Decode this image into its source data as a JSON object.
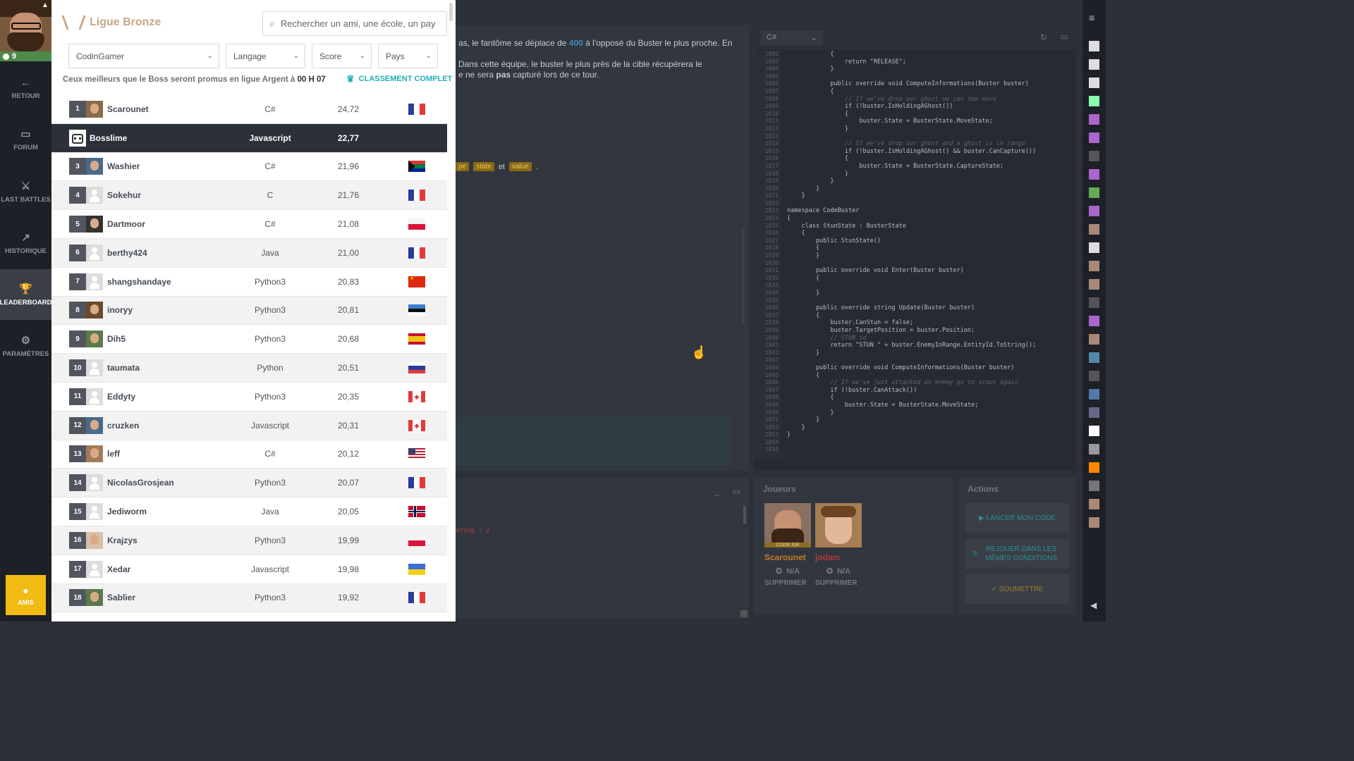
{
  "user": {
    "level": "9"
  },
  "nav": [
    {
      "id": "retour",
      "label": "RETOUR",
      "icon": "arrow-left-icon",
      "glyph": "←"
    },
    {
      "id": "forum",
      "label": "FORUM",
      "icon": "chat-icon",
      "glyph": "▭"
    },
    {
      "id": "last-battles",
      "label": "LAST BATTLES",
      "icon": "swords-icon",
      "glyph": "⚔"
    },
    {
      "id": "historique",
      "label": "HISTORIQUE",
      "icon": "chart-line-icon",
      "glyph": "↗"
    },
    {
      "id": "leaderboard",
      "label": "LEADERBOARD",
      "icon": "trophy-icon",
      "glyph": "🏆"
    },
    {
      "id": "parametres",
      "label": "PARAMÈTRES",
      "icon": "gear-icon",
      "glyph": "⚙"
    }
  ],
  "amis_label": "AMIS",
  "leaderboard": {
    "league": "Ligue Bronze",
    "search_placeholder": "Rechercher un ami, une école, un pays, ...",
    "filters": [
      "CodinGamer",
      "Langage",
      "Score",
      "Pays"
    ],
    "promo_text": "Ceux meilleurs que le Boss seront promus en ligue Argent à ",
    "promo_time": "00 H 07",
    "full_ranking": "CLASSEMENT COMPLET",
    "rows": [
      {
        "rank": "1",
        "name": "Scarounet",
        "lang": "C#",
        "score": "24,72",
        "flag": "fr",
        "avatar": "photo"
      },
      {
        "rank": "",
        "name": "Bosslime",
        "lang": "Javascript",
        "score": "22,77",
        "flag": "",
        "avatar": "boss",
        "boss": true
      },
      {
        "rank": "3",
        "name": "Washier",
        "lang": "C#",
        "score": "21,96",
        "flag": "za",
        "avatar": "photo"
      },
      {
        "rank": "4",
        "name": "Sokehur",
        "lang": "C",
        "score": "21,76",
        "flag": "fr",
        "avatar": "default"
      },
      {
        "rank": "5",
        "name": "Dartmoor",
        "lang": "C#",
        "score": "21,08",
        "flag": "pl",
        "avatar": "photo"
      },
      {
        "rank": "6",
        "name": "berthy424",
        "lang": "Java",
        "score": "21,00",
        "flag": "fr",
        "avatar": "default"
      },
      {
        "rank": "7",
        "name": "shangshandaye",
        "lang": "Python3",
        "score": "20,83",
        "flag": "cn",
        "avatar": "default"
      },
      {
        "rank": "8",
        "name": "inoryy",
        "lang": "Python3",
        "score": "20,81",
        "flag": "ee",
        "avatar": "photo"
      },
      {
        "rank": "9",
        "name": "Dih5",
        "lang": "Python3",
        "score": "20,68",
        "flag": "es",
        "avatar": "photo"
      },
      {
        "rank": "10",
        "name": "taumata",
        "lang": "Python",
        "score": "20,51",
        "flag": "ru",
        "avatar": "default"
      },
      {
        "rank": "11",
        "name": "Eddyty",
        "lang": "Python3",
        "score": "20,35",
        "flag": "ca",
        "avatar": "default"
      },
      {
        "rank": "12",
        "name": "cruzken",
        "lang": "Javascript",
        "score": "20,31",
        "flag": "ca",
        "avatar": "photo"
      },
      {
        "rank": "13",
        "name": "leff",
        "lang": "C#",
        "score": "20,12",
        "flag": "us",
        "avatar": "photo"
      },
      {
        "rank": "14",
        "name": "NicolasGrosjean",
        "lang": "Python3",
        "score": "20,07",
        "flag": "fr",
        "avatar": "default"
      },
      {
        "rank": "15",
        "name": "Jediworm",
        "lang": "Java",
        "score": "20,05",
        "flag": "no",
        "avatar": "default"
      },
      {
        "rank": "16",
        "name": "Krajzys",
        "lang": "Python3",
        "score": "19,99",
        "flag": "pl",
        "avatar": "photo"
      },
      {
        "rank": "17",
        "name": "Xedar",
        "lang": "Javascript",
        "score": "19,98",
        "flag": "ua",
        "avatar": "default"
      },
      {
        "rank": "18",
        "name": "Sablier",
        "lang": "Python3",
        "score": "19,92",
        "flag": "fr",
        "avatar": "photo"
      }
    ]
  },
  "statement": {
    "line1_a": "as, le fantôme se déplace de ",
    "line1_num": "400",
    "line1_b": " à l'opposé du Buster le plus proche. En",
    "line2": "Dans cette équipe, le buster le plus près de la cible récupérera le",
    "line3_a": "e ne sera ",
    "line3_b": "pas",
    "line3_c": " capturé lors de ce tour.",
    "tag1": "pe",
    "tag2": "state",
    "tag_sep": "et",
    "tag3": "value",
    "tag_end": "."
  },
  "editor": {
    "language": "C#",
    "code": [
      [
        "            {",
        ""
      ],
      [
        "                return \"RELEASE\";",
        ""
      ],
      [
        "            }",
        ""
      ],
      [
        "",
        ""
      ],
      [
        "            public override void ComputeInformations(Buster buster)",
        ""
      ],
      [
        "            {",
        ""
      ],
      [
        "                // If we've drop our ghost we can now move",
        "c"
      ],
      [
        "                if (!buster.IsHoldingAGhost())",
        ""
      ],
      [
        "                {",
        ""
      ],
      [
        "                    buster.State = BusterState.MoveState;",
        ""
      ],
      [
        "                }",
        ""
      ],
      [
        "",
        ""
      ],
      [
        "                // If we've drop our ghost and a ghost is in range",
        "c"
      ],
      [
        "                if (!buster.IsHoldingAGhost() && buster.CanCapture())",
        ""
      ],
      [
        "                {",
        ""
      ],
      [
        "                    buster.State = BusterState.CaptureState;",
        ""
      ],
      [
        "                }",
        ""
      ],
      [
        "            }",
        ""
      ],
      [
        "        }",
        ""
      ],
      [
        "    }",
        ""
      ],
      [
        "",
        ""
      ],
      [
        "namespace CodeBuster",
        ""
      ],
      [
        "{",
        ""
      ],
      [
        "    class StunState : BusterState",
        ""
      ],
      [
        "    {",
        ""
      ],
      [
        "        public StunState()",
        ""
      ],
      [
        "        {",
        ""
      ],
      [
        "        }",
        ""
      ],
      [
        "",
        ""
      ],
      [
        "        public override void Enter(Buster buster)",
        ""
      ],
      [
        "        {",
        ""
      ],
      [
        "",
        ""
      ],
      [
        "        }",
        ""
      ],
      [
        "",
        ""
      ],
      [
        "        public override string Update(Buster buster)",
        ""
      ],
      [
        "        {",
        ""
      ],
      [
        "            buster.CanStun = false;",
        ""
      ],
      [
        "            buster.TargetPosition = buster.Position;",
        ""
      ],
      [
        "            // STUN id",
        "c"
      ],
      [
        "            return \"STUN \" + buster.EnemyInRange.EntityId.ToString();",
        ""
      ],
      [
        "        }",
        ""
      ],
      [
        "",
        ""
      ],
      [
        "        public override void ComputeInformations(Buster buster)",
        ""
      ],
      [
        "        {",
        ""
      ],
      [
        "            // If we've just attacked an enemy go to scout again",
        "c"
      ],
      [
        "            if (!buster.CanAttack())",
        ""
      ],
      [
        "            {",
        ""
      ],
      [
        "                buster.State = BusterState.MoveState;",
        ""
      ],
      [
        "            }",
        ""
      ],
      [
        "        }",
        ""
      ],
      [
        "    }",
        ""
      ],
      [
        "}",
        ""
      ],
      [
        "",
        ""
      ],
      [
        "",
        ""
      ]
    ],
    "first_line": 1802
  },
  "console": {
    "text": "aring : 2"
  },
  "players": {
    "title": "Joueurs",
    "list": [
      {
        "name": "Scarounet",
        "label": "CODE IDE",
        "rank": "N/A",
        "delete": "SUPPRIMER",
        "color": "#c87a2a"
      },
      {
        "name": "jodam",
        "label": "",
        "rank": "N/A",
        "delete": "SUPPRIMER",
        "color": "#b23a3a"
      }
    ]
  },
  "actions": {
    "title": "Actions",
    "run": "LANCER MON CODE",
    "replay": "REJOUER DANS LES MÊMES CONDITIONS",
    "submit": "SOUMETTRE"
  },
  "colors": {
    "accent": "#25aeb6",
    "amis": "#f2bb13",
    "league": "#c9a687"
  }
}
